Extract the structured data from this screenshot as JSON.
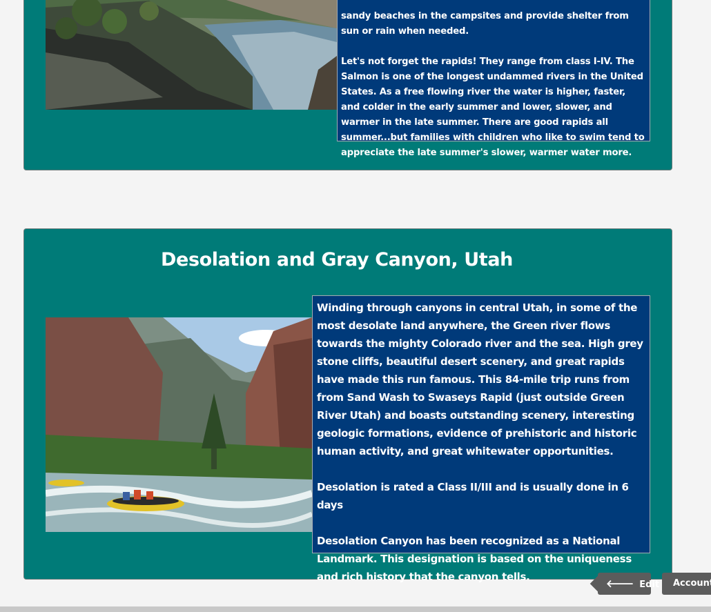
{
  "section1": {
    "paragraphs": [
      "sandy beaches in the campsites and provide shelter from sun or rain when needed.",
      "Let's not forget the rapids! They range from class I-IV. The Salmon is one of the longest undammed rivers in the United States. As a free flowing river the water is higher, faster, and colder in the early summer and lower, slower, and warmer in the late summer. There are good rapids all summer...but families with children who like to swim tend to appreciate the late summer's slower, warmer water more."
    ]
  },
  "section2": {
    "title": "Desolation and Gray Canyon, Utah",
    "paragraphs": [
      "Winding through canyons in central Utah, in some of the most desolate land anywhere, the Green river flows towards the mighty Colorado river and the sea. High grey stone cliffs, beautiful desert scenery, and great rapids have made this run famous. This 84-mile trip runs from from Sand Wash to Swaseys Rapid (just outside Green River Utah) and boasts outstanding scenery, interesting geologic formations, evidence of prehistoric and historic human activity, and great whitewater opportunities.",
      "Desolation is rated a Class II/III and is usually done in 6 days",
      "Desolation Canyon has been recognized as a National Landmark. This designation is based on the uniqueness and rich history that the canyon tells."
    ]
  },
  "toolbar": {
    "edit_label": "Edit",
    "edit_icon": "arrow-left-icon",
    "account_label": "Account"
  },
  "colors": {
    "card_background": "#007b78",
    "text_box_background": "#003a7a",
    "page_background": "#f4f4f4",
    "button_background": "#5c5c5c"
  }
}
